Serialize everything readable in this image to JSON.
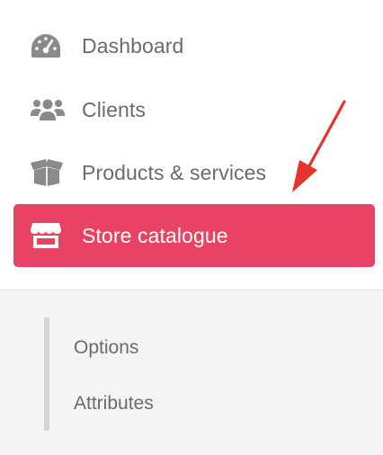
{
  "menu": {
    "items": [
      {
        "label": "Dashboard",
        "icon": "dashboard-gauge-icon"
      },
      {
        "label": "Clients",
        "icon": "users-icon"
      },
      {
        "label": "Products & services",
        "icon": "open-box-icon"
      },
      {
        "label": "Store catalogue",
        "icon": "storefront-icon",
        "active": true
      }
    ]
  },
  "submenu": {
    "items": [
      {
        "label": "Options"
      },
      {
        "label": "Attributes"
      }
    ]
  },
  "colors": {
    "accent": "#e84363",
    "text": "#6b6b6b",
    "icon": "#8a8a8a",
    "submenu_bg": "#f3f4f6",
    "annotation_arrow": "#e5322b"
  }
}
